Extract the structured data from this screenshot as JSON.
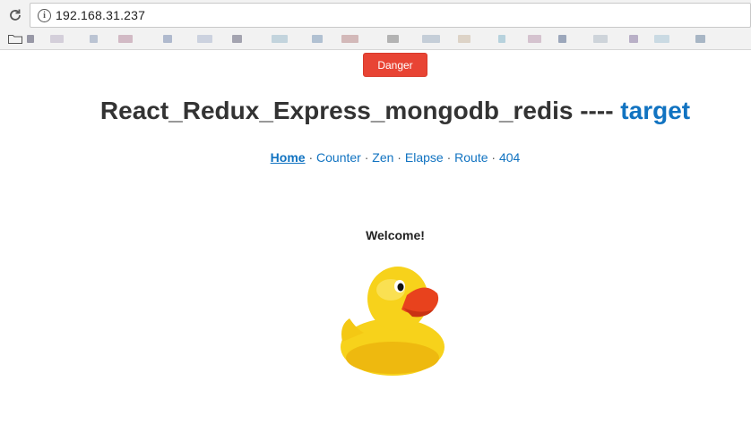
{
  "browser": {
    "url": "192.168.31.237",
    "bookmark_colors": [
      "#7a7a8c",
      "#c9c3d2",
      "#a8b4c8",
      "#c7a7b6",
      "#9aa7c1",
      "#bfc7d8",
      "#8a8a9a",
      "#b3c9d6",
      "#9bb0c7",
      "#c8a5a5",
      "#9d9d9d",
      "#b6c1cf",
      "#d6c8b8",
      "#a3c7d6",
      "#cbb3c3",
      "#7f8da8",
      "#c1c9d1",
      "#a69ab8",
      "#bcd2dd",
      "#8fa2b6"
    ]
  },
  "page": {
    "danger_button": "Danger",
    "title_main": "React_Redux_Express_mongodb_redis ---- ",
    "title_link": "target",
    "nav": {
      "home": "Home",
      "counter": "Counter",
      "zen": "Zen",
      "elapse": "Elapse",
      "route": "Route",
      "notfound": "404",
      "separator": " · "
    },
    "welcome": "Welcome!"
  },
  "colors": {
    "accent_link": "#1173c1",
    "danger": "#e84434",
    "duck_body": "#f7d21b",
    "duck_beak": "#e8421d"
  },
  "icons": {
    "reload": "reload-icon",
    "info": "info-icon",
    "folder": "folder-icon"
  }
}
